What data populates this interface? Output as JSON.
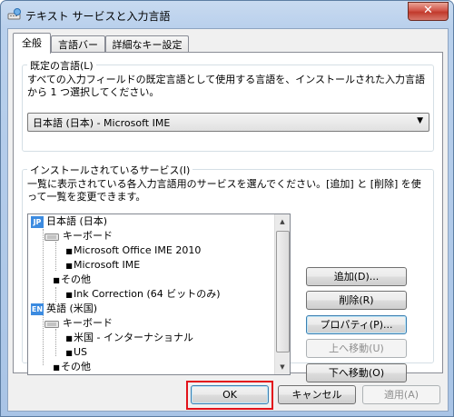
{
  "window": {
    "title": "テキスト サービスと入力言語",
    "close_glyph": "✕",
    "title_icon": "keyboard-globe-icon"
  },
  "tabs": [
    {
      "label": "全般",
      "active": true
    },
    {
      "label": "言語バー",
      "active": false
    },
    {
      "label": "詳細なキー設定",
      "active": false
    }
  ],
  "default_language": {
    "group_title": "既定の言語(L)",
    "description_line1": "すべての入力フィールドの既定言語として使用する言語を、インストールされた入力言語",
    "description_line2": "から 1 つ選択してください。",
    "selected": "日本語 (日本) - Microsoft IME"
  },
  "installed_services": {
    "group_title": "インストールされているサービス(I)",
    "description_line1": "一覧に表示されている各入力言語用のサービスを選んでください。[追加] と [削除] を使",
    "description_line2": "って一覧を変更できます。",
    "tree": [
      {
        "level": 0,
        "kind": "language",
        "badge": "JP",
        "text": "日本語 (日本)"
      },
      {
        "level": 1,
        "kind": "category",
        "text": "キーボード"
      },
      {
        "level": 2,
        "kind": "item",
        "text": "Microsoft Office IME 2010"
      },
      {
        "level": 2,
        "kind": "item",
        "text": "Microsoft IME"
      },
      {
        "level": 1,
        "kind": "item",
        "text": "その他"
      },
      {
        "level": 2,
        "kind": "item",
        "text": "Ink Correction (64 ビットのみ)"
      },
      {
        "level": 0,
        "kind": "language",
        "badge": "EN",
        "text": "英語 (米国)"
      },
      {
        "level": 1,
        "kind": "category",
        "text": "キーボード"
      },
      {
        "level": 2,
        "kind": "item",
        "text": "米国 - インターナショナル"
      },
      {
        "level": 2,
        "kind": "item",
        "text": "US"
      },
      {
        "level": 1,
        "kind": "item",
        "text": "その他"
      }
    ],
    "buttons": {
      "add": "追加(D)...",
      "remove": "削除(R)",
      "properties": "プロパティ(P)...",
      "move_up": "上へ移動(U)",
      "move_down": "下へ移動(O)"
    }
  },
  "footer": {
    "ok": "OK",
    "cancel": "キャンセル",
    "apply": "適用(A)"
  },
  "colors": {
    "highlight": "#e3121a",
    "lang_badge": "#3c8be0"
  }
}
